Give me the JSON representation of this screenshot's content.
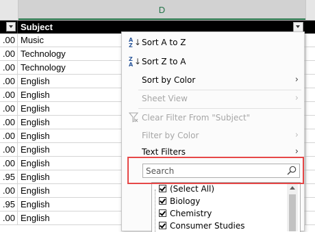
{
  "grid": {
    "column_letter": "D",
    "header": {
      "subject_label": "Subject"
    },
    "rows": [
      {
        "num": ".00",
        "subject": "Music"
      },
      {
        "num": ".00",
        "subject": "Technology"
      },
      {
        "num": ".00",
        "subject": "Technology"
      },
      {
        "num": ".00",
        "subject": "English"
      },
      {
        "num": ".00",
        "subject": "English"
      },
      {
        "num": ".00",
        "subject": "English"
      },
      {
        "num": ".00",
        "subject": "English"
      },
      {
        "num": ".00",
        "subject": "English"
      },
      {
        "num": ".00",
        "subject": "English"
      },
      {
        "num": ".00",
        "subject": "English"
      },
      {
        "num": ".95",
        "subject": "English"
      },
      {
        "num": ".00",
        "subject": "English"
      },
      {
        "num": ".95",
        "subject": "English"
      },
      {
        "num": ".00",
        "subject": "English"
      }
    ]
  },
  "menu": {
    "sort_az": "Sort A to Z",
    "sort_za": "Sort Z to A",
    "sort_by_color": "Sort by Color",
    "sheet_view": "Sheet View",
    "clear_filter": "Clear Filter From \"Subject\"",
    "filter_by_color": "Filter by Color",
    "text_filters": "Text Filters",
    "search_placeholder": "Search",
    "list": [
      "(Select All)",
      "Biology",
      "Chemistry",
      "Consumer Studies"
    ],
    "sort_icon_letters": {
      "a": "A",
      "z": "Z"
    }
  },
  "colors": {
    "highlight": "#e64646",
    "excel_green": "#217346",
    "header_bg": "#000000"
  },
  "icons": {
    "sort_az": "sort-ascending-icon",
    "sort_za": "sort-descending-icon",
    "clear_filter": "clear-filter-icon",
    "search": "search-icon",
    "submenu": "chevron-right-icon",
    "dropdown": "filter-dropdown-icon"
  }
}
